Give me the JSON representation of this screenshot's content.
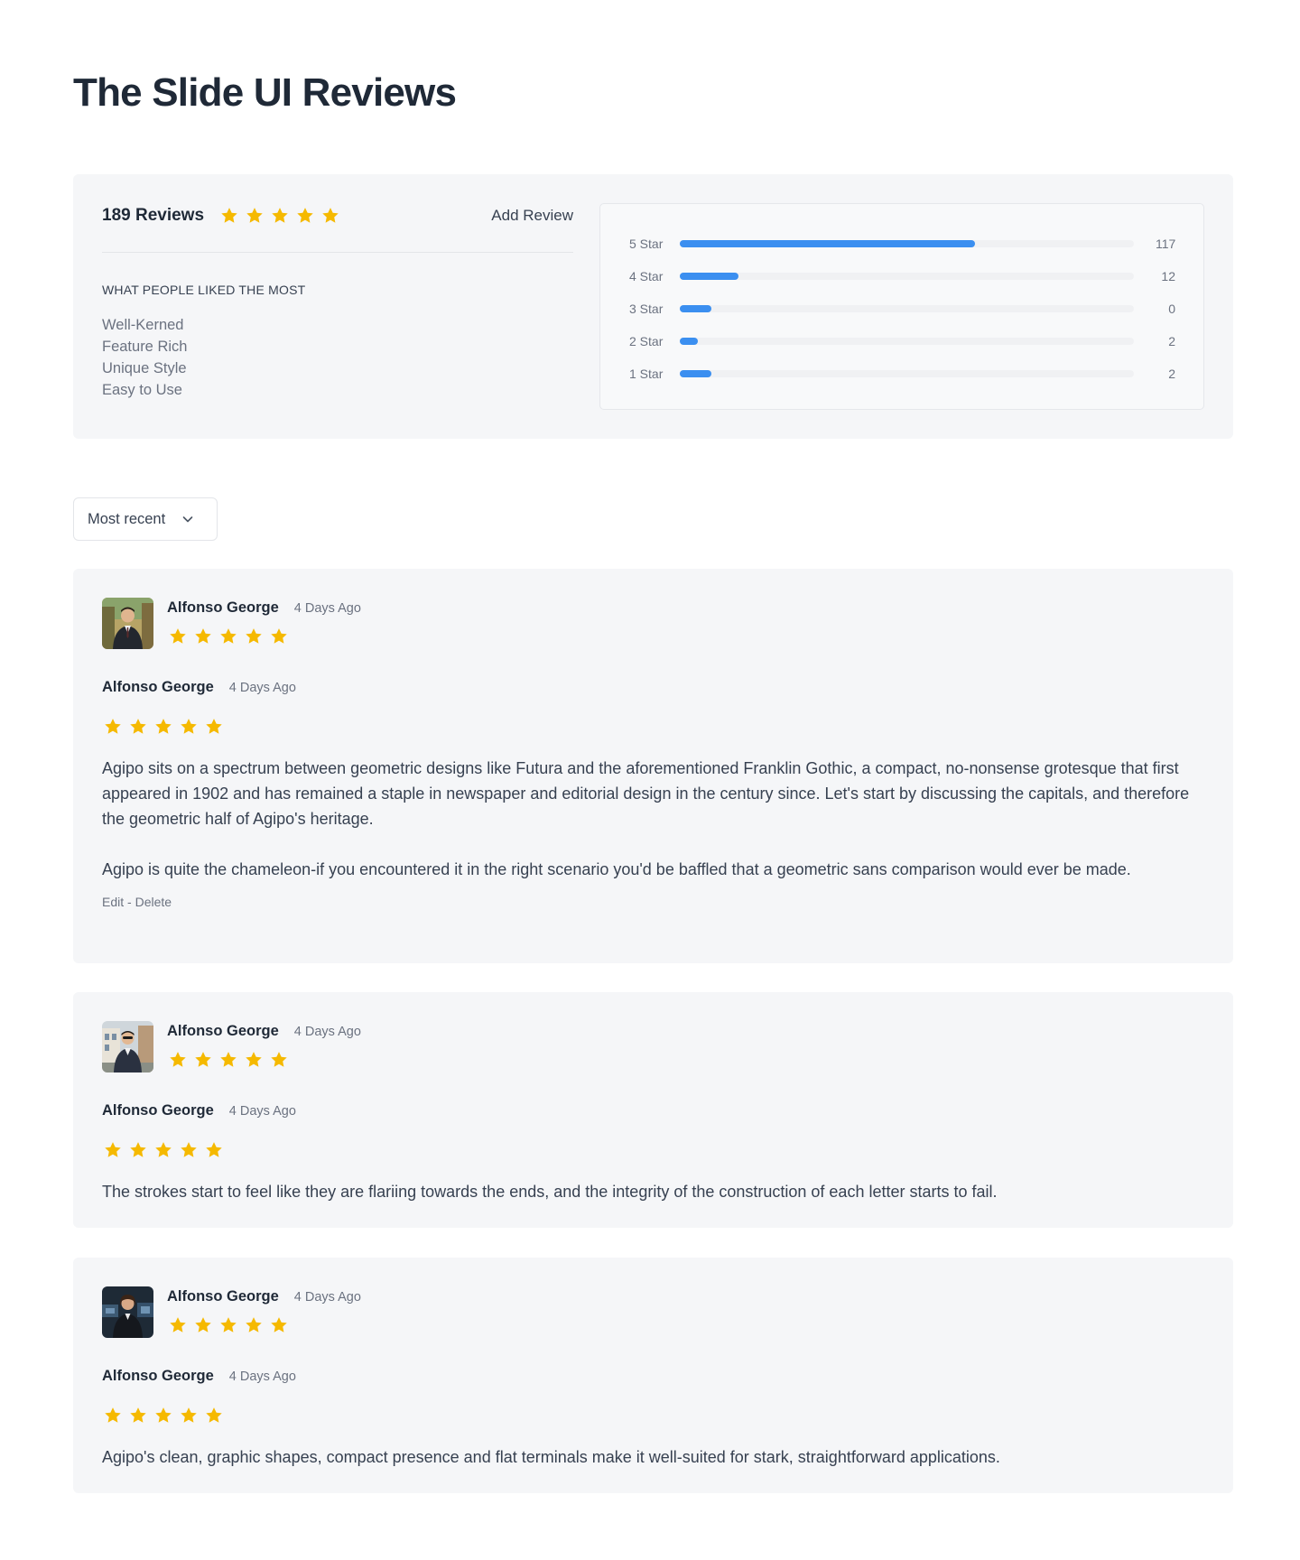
{
  "page": {
    "title": "The Slide UI Reviews"
  },
  "summary": {
    "review_count": "189 Reviews",
    "rating": 5,
    "add_review_label": "Add Review",
    "liked_title": "WHAT PEOPLE LIKED THE MOST",
    "liked_items": [
      "Well-Kerned",
      "Feature Rich",
      "Unique Style",
      "Easy to Use"
    ]
  },
  "breakdown": [
    {
      "label": "5 Star",
      "count": "117",
      "fill_fraction": 0.65
    },
    {
      "label": "4 Star",
      "count": "12",
      "fill_fraction": 0.13
    },
    {
      "label": "3 Star",
      "count": "0",
      "fill_fraction": 0.07
    },
    {
      "label": "2 Star",
      "count": "2",
      "fill_fraction": 0.04
    },
    {
      "label": "1 Star",
      "count": "2",
      "fill_fraction": 0.07
    }
  ],
  "sort": {
    "label": "Most recent"
  },
  "reviews": [
    {
      "author": "Alfonso George",
      "date": "4 Days Ago",
      "rating": 5,
      "body_author": "Alfonso George",
      "body_date": "4 Days Ago",
      "paragraphs": [
        "Agipo sits on a spectrum between geometric designs like Futura and the aforementioned Franklin Gothic, a compact, no-nonsense grotesque that first appeared in 1902 and has remained a staple in newspaper and editorial design in the century since. Let's start by discussing the capitals, and therefore the geometric half of Agipo's heritage.",
        "Agipo is quite the chameleon-if you encountered it in the right scenario you'd be baffled that a geometric sans comparison would ever be made."
      ],
      "edit_label": "Edit",
      "separator": " - ",
      "delete_label": "Delete"
    },
    {
      "author": "Alfonso George",
      "date": "4 Days Ago",
      "rating": 5,
      "body_author": "Alfonso George",
      "body_date": "4 Days Ago",
      "paragraphs": [
        "The strokes start to feel like they are flariing towards the ends, and the integrity of the construction of each letter starts to fail."
      ]
    },
    {
      "author": "Alfonso George",
      "date": "4 Days Ago",
      "rating": 5,
      "body_author": "Alfonso George",
      "body_date": "4 Days Ago",
      "paragraphs": [
        "Agipo's clean, graphic shapes, compact presence and flat terminals make it well-suited for stark, straightforward applications."
      ]
    }
  ],
  "colors": {
    "star": "#f5b900",
    "bar": "#3b8ff0",
    "card_bg": "#f5f6f8"
  },
  "icons": {
    "star": "star-icon",
    "chevron": "chevron-down-icon"
  }
}
